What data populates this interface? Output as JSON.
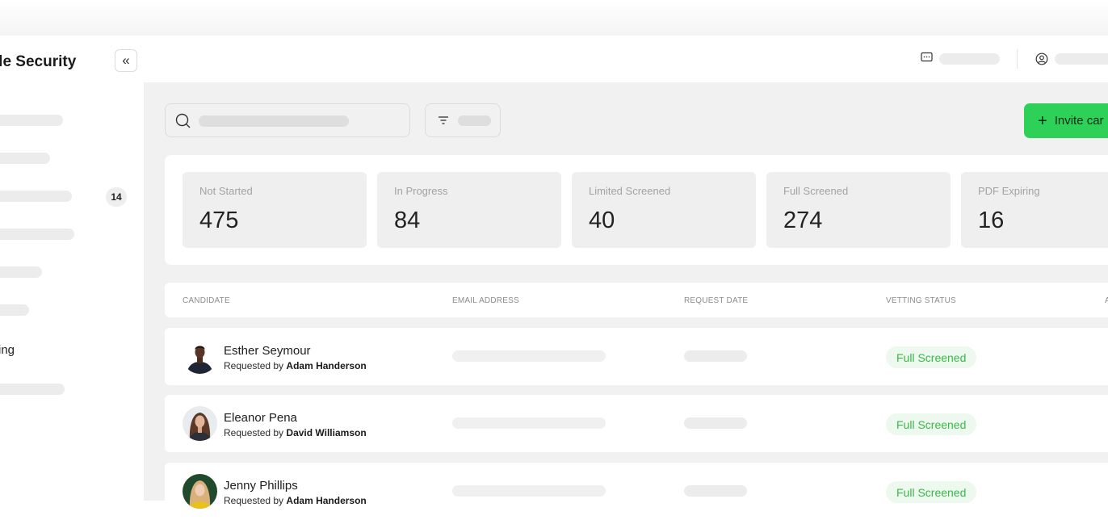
{
  "sidebar": {
    "brand": "agle Security",
    "collapse_icon": "«",
    "badge": "14",
    "partial_item": "ing"
  },
  "stats": [
    {
      "label": "Not Started",
      "value": "475"
    },
    {
      "label": "In Progress",
      "value": "84"
    },
    {
      "label": "Limited Screened",
      "value": "40"
    },
    {
      "label": "Full Screened",
      "value": "274"
    },
    {
      "label": "PDF Expiring",
      "value": "16"
    }
  ],
  "toolbar": {
    "invite_plus": "+",
    "invite_label": "Invite car"
  },
  "table": {
    "headers": {
      "candidate": "CANDIDATE",
      "email": "EMAIL ADDRESS",
      "date": "REQUEST DATE",
      "status": "VETTING STATUS",
      "partial": "A"
    },
    "rows": [
      {
        "name": "Esther Seymour",
        "requested_prefix": "Requested by",
        "requested_by": "Adam Handerson",
        "status": "Full Screened"
      },
      {
        "name": "Eleanor Pena",
        "requested_prefix": "Requested by",
        "requested_by": "David Williamson",
        "status": "Full Screened"
      },
      {
        "name": "Jenny Phillips",
        "requested_prefix": "Requested by",
        "requested_by": "Adam Handerson",
        "status": "Full Screened"
      }
    ]
  },
  "colors": {
    "accent_green": "#2ed158",
    "status_green_text": "#3ab84a",
    "status_green_bg": "#edf8ee",
    "main_bg": "#f1f1f1"
  },
  "icons": {
    "header_left": "chat-icon",
    "header_right": "user-circle-icon",
    "search": "search-icon",
    "filter": "filter-icon"
  }
}
